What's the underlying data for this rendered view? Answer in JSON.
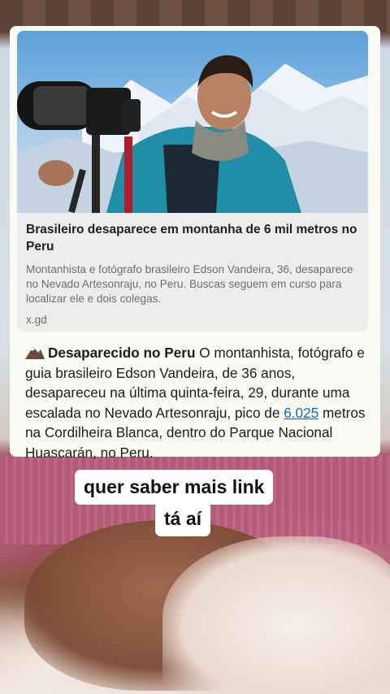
{
  "post": {
    "link_preview": {
      "title": "Brasileiro desaparece em montanha de 6 mil metros no Peru",
      "description": "Montanhista e fotógrafo brasileiro Edson Vandeira, 36, desaparece no Nevado Artesonraju, no Peru. Buscas seguem em curso para localizar ele e dois colegas.",
      "domain": "x.gd",
      "image_icon": "photographer-on-mountain"
    },
    "message": {
      "emoji_icon": "snow-capped-mountain-icon",
      "lead": "Desaparecido no Peru",
      "text_before_link": " O montanhista, fotógrafo e guia brasileiro Edson Vandeira, de 36 anos, desapareceu na última quinta-feira, 29, durante uma escalada no Nevado Artesonraju, pico de ",
      "link_text": "6.025",
      "text_after_link": " metros na Cordilheira Blanca, dentro do Parque Nacional Huascarán, no Peru."
    }
  },
  "caption": {
    "line1": "quer saber mais link",
    "line2": "tá aí"
  },
  "colors": {
    "card_background": "#fbfbf5",
    "preview_background": "#ededed",
    "link": "#1565c0",
    "caption_background": "#ffffff"
  }
}
